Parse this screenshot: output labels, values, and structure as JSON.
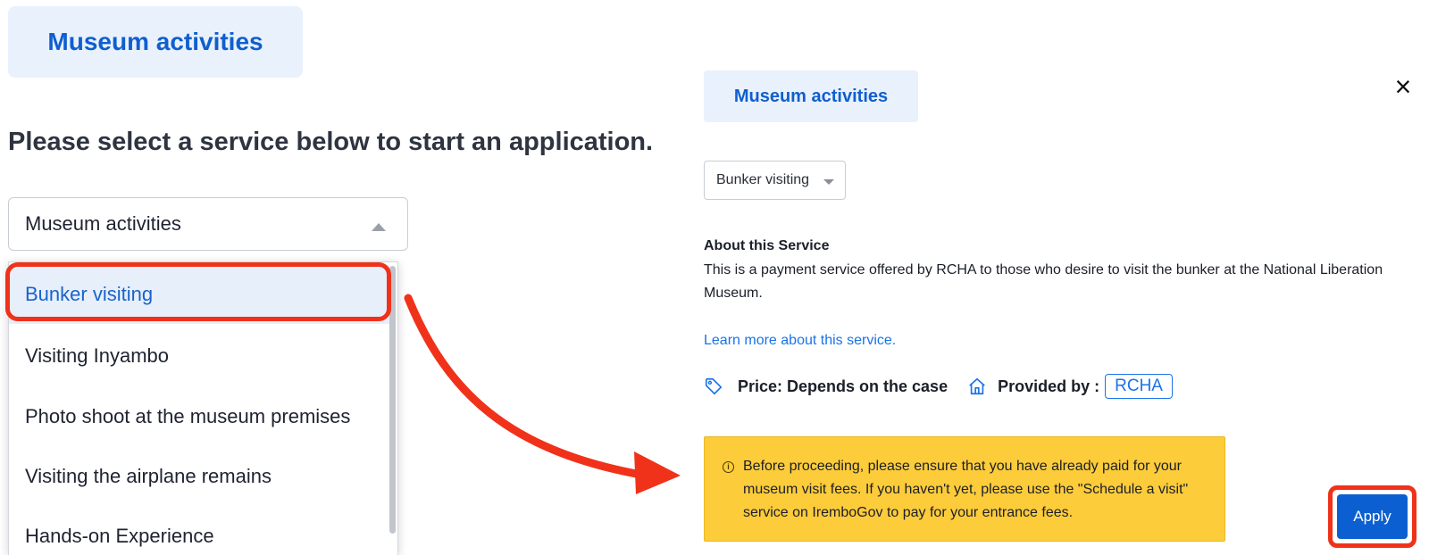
{
  "left_panel": {
    "category_chip": "Museum activities",
    "heading": "Please select a service below to start an application.",
    "category_select": {
      "value": "Museum activities"
    },
    "dropdown_options": [
      {
        "label": "Bunker visiting",
        "selected": true
      },
      {
        "label": "Visiting Inyambo",
        "selected": false
      },
      {
        "label": "Photo shoot at the museum premises",
        "selected": false
      },
      {
        "label": "Visiting the airplane remains",
        "selected": false
      },
      {
        "label": "Hands-on Experience",
        "selected": false
      }
    ]
  },
  "right_panel": {
    "category_chip": "Museum activities",
    "close_icon": "×",
    "service_select": {
      "value": "Bunker visiting"
    },
    "about": {
      "title": "About this Service",
      "description": "This is a payment service offered by RCHA to those who desire to visit the bunker at the National Liberation Museum.",
      "learn_more": "Learn more about this service."
    },
    "price_label": "Price: Depends on the case",
    "provided_by_label": "Provided by :",
    "provider": "RCHA",
    "notice_icon": "i",
    "notice": "Before proceeding, please ensure that you have already paid for your museum visit fees. If you haven't yet, please use the \"Schedule a visit\" service on IremboGov to pay for your entrance fees.",
    "apply_button": "Apply"
  },
  "icons": {
    "price": "tag-icon",
    "provider": "home-icon",
    "notice": "info-icon",
    "close": "close-icon"
  },
  "colors": {
    "brand_blue": "#0f5fcf",
    "chip_background": "#e9f1fc",
    "link_blue": "#1a73e8",
    "notice_yellow": "#fdcc3a",
    "annotation_red": "#f0321a",
    "apply_button": "#0c5fd1"
  }
}
